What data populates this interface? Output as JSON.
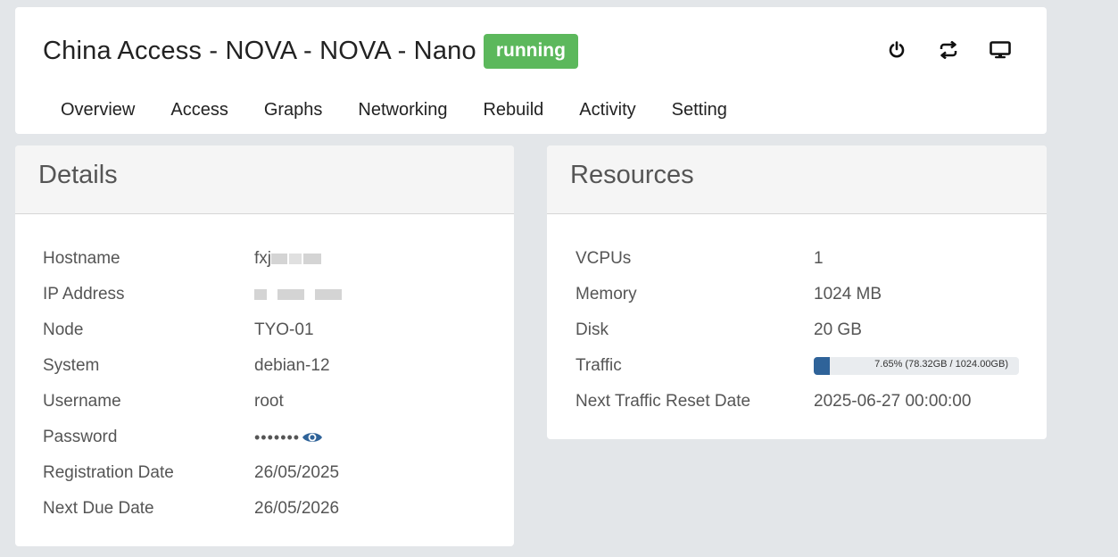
{
  "header": {
    "title": "China Access - NOVA - NOVA - Nano",
    "status": "running",
    "actions": [
      {
        "icon": "power-icon"
      },
      {
        "icon": "restart-icon"
      },
      {
        "icon": "console-icon"
      }
    ],
    "tabs": [
      "Overview",
      "Access",
      "Graphs",
      "Networking",
      "Rebuild",
      "Activity",
      "Setting"
    ]
  },
  "details": {
    "title": "Details",
    "rows": [
      {
        "label": "Hostname",
        "value": "fxj"
      },
      {
        "label": "IP Address",
        "value": ""
      },
      {
        "label": "Node",
        "value": "TYO-01"
      },
      {
        "label": "System",
        "value": "debian-12"
      },
      {
        "label": "Username",
        "value": "root"
      },
      {
        "label": "Password",
        "value": "•••••••"
      },
      {
        "label": "Registration Date",
        "value": "26/05/2025"
      },
      {
        "label": "Next Due Date",
        "value": "26/05/2026"
      }
    ]
  },
  "resources": {
    "title": "Resources",
    "rows": [
      {
        "label": "VCPUs",
        "value": "1"
      },
      {
        "label": "Memory",
        "value": "1024 MB"
      },
      {
        "label": "Disk",
        "value": "20 GB"
      },
      {
        "label": "Traffic",
        "value": "7.65% (78.32GB / 1024.00GB)",
        "fraction": 0.0765
      },
      {
        "label": "Next Traffic Reset Date",
        "value": "2025-06-27 00:00:00"
      }
    ]
  },
  "colors": {
    "running": "#5cb85c",
    "progress": "#2f6399",
    "eye": "#2f6399"
  }
}
